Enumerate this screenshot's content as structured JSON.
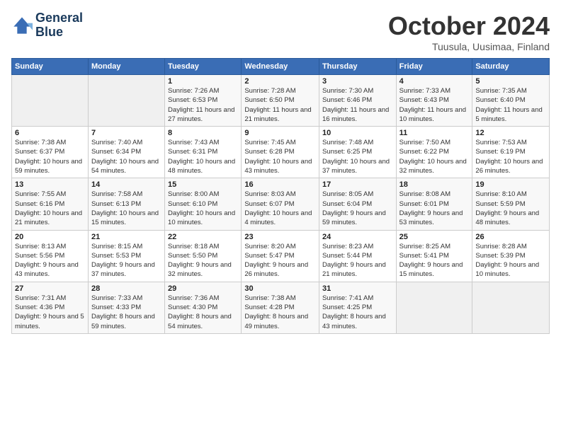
{
  "logo": {
    "line1": "General",
    "line2": "Blue"
  },
  "title": "October 2024",
  "location": "Tuusula, Uusimaa, Finland",
  "days_header": [
    "Sunday",
    "Monday",
    "Tuesday",
    "Wednesday",
    "Thursday",
    "Friday",
    "Saturday"
  ],
  "weeks": [
    [
      {
        "num": "",
        "sunrise": "",
        "sunset": "",
        "daylight": ""
      },
      {
        "num": "",
        "sunrise": "",
        "sunset": "",
        "daylight": ""
      },
      {
        "num": "1",
        "sunrise": "Sunrise: 7:26 AM",
        "sunset": "Sunset: 6:53 PM",
        "daylight": "Daylight: 11 hours and 27 minutes."
      },
      {
        "num": "2",
        "sunrise": "Sunrise: 7:28 AM",
        "sunset": "Sunset: 6:50 PM",
        "daylight": "Daylight: 11 hours and 21 minutes."
      },
      {
        "num": "3",
        "sunrise": "Sunrise: 7:30 AM",
        "sunset": "Sunset: 6:46 PM",
        "daylight": "Daylight: 11 hours and 16 minutes."
      },
      {
        "num": "4",
        "sunrise": "Sunrise: 7:33 AM",
        "sunset": "Sunset: 6:43 PM",
        "daylight": "Daylight: 11 hours and 10 minutes."
      },
      {
        "num": "5",
        "sunrise": "Sunrise: 7:35 AM",
        "sunset": "Sunset: 6:40 PM",
        "daylight": "Daylight: 11 hours and 5 minutes."
      }
    ],
    [
      {
        "num": "6",
        "sunrise": "Sunrise: 7:38 AM",
        "sunset": "Sunset: 6:37 PM",
        "daylight": "Daylight: 10 hours and 59 minutes."
      },
      {
        "num": "7",
        "sunrise": "Sunrise: 7:40 AM",
        "sunset": "Sunset: 6:34 PM",
        "daylight": "Daylight: 10 hours and 54 minutes."
      },
      {
        "num": "8",
        "sunrise": "Sunrise: 7:43 AM",
        "sunset": "Sunset: 6:31 PM",
        "daylight": "Daylight: 10 hours and 48 minutes."
      },
      {
        "num": "9",
        "sunrise": "Sunrise: 7:45 AM",
        "sunset": "Sunset: 6:28 PM",
        "daylight": "Daylight: 10 hours and 43 minutes."
      },
      {
        "num": "10",
        "sunrise": "Sunrise: 7:48 AM",
        "sunset": "Sunset: 6:25 PM",
        "daylight": "Daylight: 10 hours and 37 minutes."
      },
      {
        "num": "11",
        "sunrise": "Sunrise: 7:50 AM",
        "sunset": "Sunset: 6:22 PM",
        "daylight": "Daylight: 10 hours and 32 minutes."
      },
      {
        "num": "12",
        "sunrise": "Sunrise: 7:53 AM",
        "sunset": "Sunset: 6:19 PM",
        "daylight": "Daylight: 10 hours and 26 minutes."
      }
    ],
    [
      {
        "num": "13",
        "sunrise": "Sunrise: 7:55 AM",
        "sunset": "Sunset: 6:16 PM",
        "daylight": "Daylight: 10 hours and 21 minutes."
      },
      {
        "num": "14",
        "sunrise": "Sunrise: 7:58 AM",
        "sunset": "Sunset: 6:13 PM",
        "daylight": "Daylight: 10 hours and 15 minutes."
      },
      {
        "num": "15",
        "sunrise": "Sunrise: 8:00 AM",
        "sunset": "Sunset: 6:10 PM",
        "daylight": "Daylight: 10 hours and 10 minutes."
      },
      {
        "num": "16",
        "sunrise": "Sunrise: 8:03 AM",
        "sunset": "Sunset: 6:07 PM",
        "daylight": "Daylight: 10 hours and 4 minutes."
      },
      {
        "num": "17",
        "sunrise": "Sunrise: 8:05 AM",
        "sunset": "Sunset: 6:04 PM",
        "daylight": "Daylight: 9 hours and 59 minutes."
      },
      {
        "num": "18",
        "sunrise": "Sunrise: 8:08 AM",
        "sunset": "Sunset: 6:01 PM",
        "daylight": "Daylight: 9 hours and 53 minutes."
      },
      {
        "num": "19",
        "sunrise": "Sunrise: 8:10 AM",
        "sunset": "Sunset: 5:59 PM",
        "daylight": "Daylight: 9 hours and 48 minutes."
      }
    ],
    [
      {
        "num": "20",
        "sunrise": "Sunrise: 8:13 AM",
        "sunset": "Sunset: 5:56 PM",
        "daylight": "Daylight: 9 hours and 43 minutes."
      },
      {
        "num": "21",
        "sunrise": "Sunrise: 8:15 AM",
        "sunset": "Sunset: 5:53 PM",
        "daylight": "Daylight: 9 hours and 37 minutes."
      },
      {
        "num": "22",
        "sunrise": "Sunrise: 8:18 AM",
        "sunset": "Sunset: 5:50 PM",
        "daylight": "Daylight: 9 hours and 32 minutes."
      },
      {
        "num": "23",
        "sunrise": "Sunrise: 8:20 AM",
        "sunset": "Sunset: 5:47 PM",
        "daylight": "Daylight: 9 hours and 26 minutes."
      },
      {
        "num": "24",
        "sunrise": "Sunrise: 8:23 AM",
        "sunset": "Sunset: 5:44 PM",
        "daylight": "Daylight: 9 hours and 21 minutes."
      },
      {
        "num": "25",
        "sunrise": "Sunrise: 8:25 AM",
        "sunset": "Sunset: 5:41 PM",
        "daylight": "Daylight: 9 hours and 15 minutes."
      },
      {
        "num": "26",
        "sunrise": "Sunrise: 8:28 AM",
        "sunset": "Sunset: 5:39 PM",
        "daylight": "Daylight: 9 hours and 10 minutes."
      }
    ],
    [
      {
        "num": "27",
        "sunrise": "Sunrise: 7:31 AM",
        "sunset": "Sunset: 4:36 PM",
        "daylight": "Daylight: 9 hours and 5 minutes."
      },
      {
        "num": "28",
        "sunrise": "Sunrise: 7:33 AM",
        "sunset": "Sunset: 4:33 PM",
        "daylight": "Daylight: 8 hours and 59 minutes."
      },
      {
        "num": "29",
        "sunrise": "Sunrise: 7:36 AM",
        "sunset": "Sunset: 4:30 PM",
        "daylight": "Daylight: 8 hours and 54 minutes."
      },
      {
        "num": "30",
        "sunrise": "Sunrise: 7:38 AM",
        "sunset": "Sunset: 4:28 PM",
        "daylight": "Daylight: 8 hours and 49 minutes."
      },
      {
        "num": "31",
        "sunrise": "Sunrise: 7:41 AM",
        "sunset": "Sunset: 4:25 PM",
        "daylight": "Daylight: 8 hours and 43 minutes."
      },
      {
        "num": "",
        "sunrise": "",
        "sunset": "",
        "daylight": ""
      },
      {
        "num": "",
        "sunrise": "",
        "sunset": "",
        "daylight": ""
      }
    ]
  ]
}
